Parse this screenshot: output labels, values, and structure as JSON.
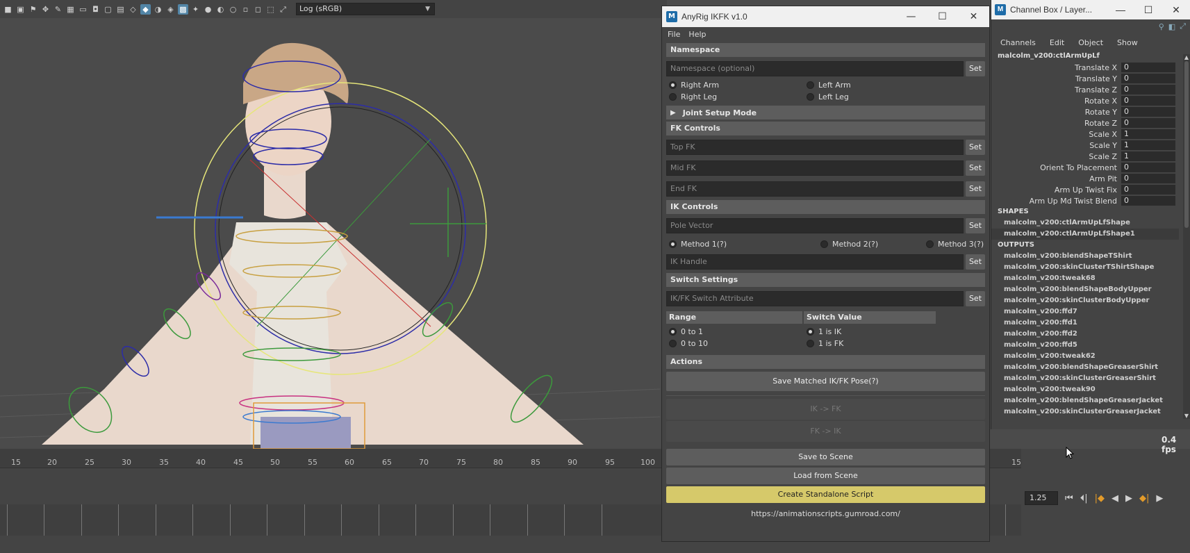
{
  "viewport": {
    "color_space": "Log (sRGB)"
  },
  "timeline": {
    "ruler_labels": [
      "15",
      "20",
      "25",
      "30",
      "35",
      "40",
      "45",
      "50",
      "55",
      "60",
      "65",
      "70",
      "75",
      "80",
      "85",
      "90",
      "95",
      "100"
    ],
    "ruler_right_label": "15",
    "current_frame": "1.25",
    "fps": "0.4 fps"
  },
  "anyrig": {
    "title": "AnyRig IKFK v1.0",
    "menu": {
      "file": "File",
      "help": "Help"
    },
    "namespace": {
      "header": "Namespace",
      "placeholder": "Namespace (optional)",
      "set": "Set",
      "options": [
        "Right Arm",
        "Left Arm",
        "Right Leg",
        "Left Leg"
      ]
    },
    "joint_setup": "Joint Setup Mode",
    "fk": {
      "header": "FK Controls",
      "top": "Top FK",
      "mid": "Mid FK",
      "end": "End FK",
      "set": "Set"
    },
    "ik": {
      "header": "IK Controls",
      "pole": "Pole Vector",
      "methods": [
        "Method 1(?)",
        "Method 2(?)",
        "Method 3(?)"
      ],
      "handle": "IK Handle",
      "set": "Set"
    },
    "switch": {
      "header": "Switch Settings",
      "attr": "IK/FK Switch Attribute",
      "set": "Set",
      "range_label": "Range",
      "value_label": "Switch Value",
      "range_options": [
        "0 to 1",
        "0 to 10"
      ],
      "value_options": [
        "1 is IK",
        "1 is FK"
      ]
    },
    "actions": {
      "header": "Actions",
      "save_matched": "Save Matched IK/FK Pose(?)",
      "ik_to_fk": "IK -> FK",
      "fk_to_ik": "FK -> IK",
      "save_scene": "Save to Scene",
      "load_scene": "Load from Scene",
      "standalone": "Create Standalone Script"
    },
    "link": "https://animationscripts.gumroad.com/"
  },
  "channel_box": {
    "title": "Channel Box / Layer...",
    "menu": [
      "Channels",
      "Edit",
      "Object",
      "Show"
    ],
    "object": "malcolm_v200:ctlArmUpLf",
    "attributes": [
      {
        "name": "Translate X",
        "value": "0"
      },
      {
        "name": "Translate Y",
        "value": "0"
      },
      {
        "name": "Translate Z",
        "value": "0"
      },
      {
        "name": "Rotate X",
        "value": "0"
      },
      {
        "name": "Rotate Y",
        "value": "0"
      },
      {
        "name": "Rotate Z",
        "value": "0"
      },
      {
        "name": "Scale X",
        "value": "1"
      },
      {
        "name": "Scale Y",
        "value": "1"
      },
      {
        "name": "Scale Z",
        "value": "1"
      },
      {
        "name": "Orient To Placement",
        "value": "0"
      },
      {
        "name": "Arm Pit",
        "value": "0"
      },
      {
        "name": "Arm Up Twist Fix",
        "value": "0"
      },
      {
        "name": "Arm Up Md Twist Blend",
        "value": "0"
      }
    ],
    "shapes_label": "SHAPES",
    "shapes": [
      "malcolm_v200:ctlArmUpLfShape",
      "malcolm_v200:ctlArmUpLfShape1"
    ],
    "outputs_label": "OUTPUTS",
    "outputs": [
      "malcolm_v200:blendShapeTShirt",
      "malcolm_v200:skinClusterTShirtShape",
      "malcolm_v200:tweak68",
      "malcolm_v200:blendShapeBodyUpper",
      "malcolm_v200:skinClusterBodyUpper",
      "malcolm_v200:ffd7",
      "malcolm_v200:ffd1",
      "malcolm_v200:ffd2",
      "malcolm_v200:ffd5",
      "malcolm_v200:tweak62",
      "malcolm_v200:blendShapeGreaserShirt",
      "malcolm_v200:skinClusterGreaserShirt",
      "malcolm_v200:tweak90",
      "malcolm_v200:blendShapeGreaserJacket",
      "malcolm_v200:skinClusterGreaserJacket"
    ]
  }
}
